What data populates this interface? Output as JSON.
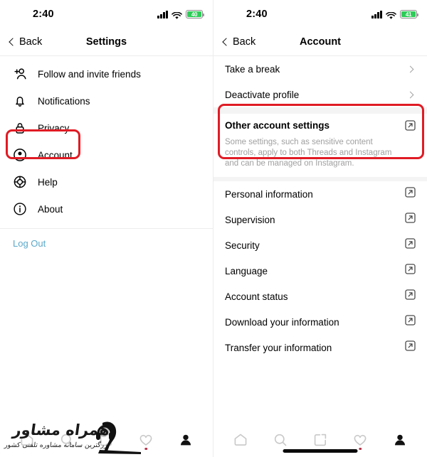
{
  "left_screen": {
    "status_bar": {
      "time": "2:40",
      "battery_text": "40",
      "signal_icon": "cellular-signal-icon",
      "wifi_icon": "wifi-icon",
      "battery_icon": "battery-icon"
    },
    "nav": {
      "back_label": "Back",
      "title": "Settings",
      "back_icon": "chevron-left-icon"
    },
    "items": [
      {
        "label": "Follow and invite friends",
        "icon": "add-person-icon"
      },
      {
        "label": "Notifications",
        "icon": "bell-icon"
      },
      {
        "label": "Privacy",
        "icon": "lock-icon"
      },
      {
        "label": "Account",
        "icon": "account-circle-icon"
      },
      {
        "label": "Help",
        "icon": "lifebuoy-icon"
      },
      {
        "label": "About",
        "icon": "info-circle-icon"
      }
    ],
    "logout_label": "Log Out",
    "highlight_target": "Account"
  },
  "right_screen": {
    "status_bar": {
      "time": "2:40",
      "battery_text": "41",
      "signal_icon": "cellular-signal-icon",
      "wifi_icon": "wifi-icon",
      "battery_icon": "battery-icon"
    },
    "nav": {
      "back_label": "Back",
      "title": "Account",
      "back_icon": "chevron-left-icon"
    },
    "chevron_items": [
      {
        "label": "Take a break",
        "icon": "chevron-right-icon"
      },
      {
        "label": "Deactivate profile",
        "icon": "chevron-right-icon"
      }
    ],
    "other_account_settings": {
      "title": "Other account settings",
      "description": "Some settings, such as sensitive content controls, apply to both Threads and Instagram and can be managed on Instagram.",
      "icon": "external-link-icon"
    },
    "link_items": [
      {
        "label": "Personal information",
        "icon": "external-link-icon"
      },
      {
        "label": "Supervision",
        "icon": "external-link-icon"
      },
      {
        "label": "Security",
        "icon": "external-link-icon"
      },
      {
        "label": "Language",
        "icon": "external-link-icon"
      },
      {
        "label": "Account status",
        "icon": "external-link-icon"
      },
      {
        "label": "Download your information",
        "icon": "external-link-icon"
      },
      {
        "label": "Transfer your information",
        "icon": "external-link-icon"
      }
    ],
    "highlight_target": "Other account settings"
  },
  "tab_bar": {
    "items": [
      {
        "name": "home",
        "icon": "home-icon",
        "active": false,
        "badge": false
      },
      {
        "name": "search",
        "icon": "search-icon",
        "active": false,
        "badge": false
      },
      {
        "name": "compose",
        "icon": "compose-icon",
        "active": false,
        "badge": false
      },
      {
        "name": "activity",
        "icon": "heart-icon",
        "active": false,
        "badge": true
      },
      {
        "name": "profile",
        "icon": "profile-icon",
        "active": true,
        "badge": false
      }
    ]
  },
  "watermark": {
    "main_text": "همراه مشاور",
    "sub_text": "بزرگترین سامانه مشاوره تلفنی کشور"
  },
  "colors": {
    "highlight_red": "#e01b24",
    "logout_blue": "#5aa8c9",
    "battery_green": "#2ecc58",
    "muted_text": "#a0a0a0",
    "badge_red": "#b5334a"
  }
}
